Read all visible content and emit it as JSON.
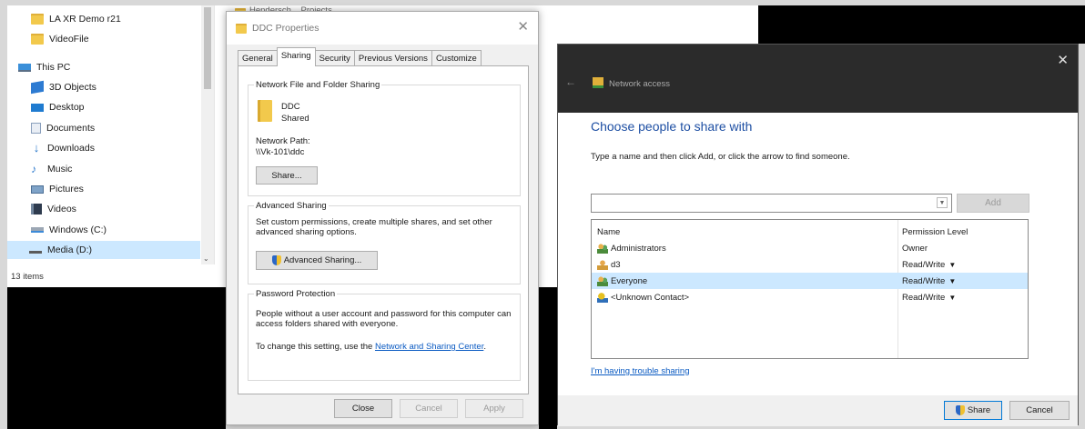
{
  "explorer": {
    "top_folder": "Hendersch... Projects",
    "nav_items": [
      {
        "label": "LA XR Demo r21",
        "icon": "folder-icon"
      },
      {
        "label": "VideoFile",
        "icon": "folder-icon"
      },
      {
        "label": "This PC",
        "icon": "this-pc-icon"
      },
      {
        "label": "3D Objects",
        "icon": "3d-objects-icon"
      },
      {
        "label": "Desktop",
        "icon": "desktop-icon"
      },
      {
        "label": "Documents",
        "icon": "documents-icon"
      },
      {
        "label": "Downloads",
        "icon": "downloads-icon"
      },
      {
        "label": "Music",
        "icon": "music-icon"
      },
      {
        "label": "Pictures",
        "icon": "pictures-icon"
      },
      {
        "label": "Videos",
        "icon": "videos-icon"
      },
      {
        "label": "Windows (C:)",
        "icon": "drive-icon"
      },
      {
        "label": "Media (D:)",
        "icon": "media-drive-icon"
      }
    ],
    "status": "13 items"
  },
  "properties": {
    "title": "DDC Properties",
    "tabs": [
      "General",
      "Sharing",
      "Security",
      "Previous Versions",
      "Customize"
    ],
    "active_tab": "Sharing",
    "network_sharing": {
      "group_title": "Network File and Folder Sharing",
      "folder_name": "DDC",
      "folder_state": "Shared",
      "path_label": "Network Path:",
      "path_value": "\\\\Vk-101\\ddc",
      "share_button": "Share..."
    },
    "advanced_sharing": {
      "group_title": "Advanced Sharing",
      "description": "Set custom permissions, create multiple shares, and set other advanced sharing options.",
      "button": "Advanced Sharing..."
    },
    "password_protection": {
      "group_title": "Password Protection",
      "description": "People without a user account and password for this computer can access folders shared with everyone.",
      "change_prefix": "To change this setting, use the ",
      "link": "Network and Sharing Center",
      "change_suffix": "."
    },
    "footer": {
      "close": "Close",
      "cancel": "Cancel",
      "apply": "Apply"
    }
  },
  "network_access": {
    "window_title": "Network access",
    "heading": "Choose people to share with",
    "instructions": "Type a name and then click Add, or click the arrow to find someone.",
    "input_value": "",
    "add_button": "Add",
    "columns": {
      "name": "Name",
      "permission": "Permission Level"
    },
    "rows": [
      {
        "name": "Administrators",
        "permission": "Owner",
        "has_dropdown": false,
        "icon": "user-group-icon"
      },
      {
        "name": "d3",
        "permission": "Read/Write",
        "has_dropdown": true,
        "icon": "user-icon"
      },
      {
        "name": "Everyone",
        "permission": "Read/Write",
        "has_dropdown": true,
        "icon": "user-group-icon"
      },
      {
        "name": "<Unknown Contact>",
        "permission": "Read/Write",
        "has_dropdown": true,
        "icon": "unknown-contact-icon"
      }
    ],
    "selected_row": "Everyone",
    "trouble_link": "I'm having trouble sharing",
    "share_button": "Share",
    "cancel_button": "Cancel"
  }
}
